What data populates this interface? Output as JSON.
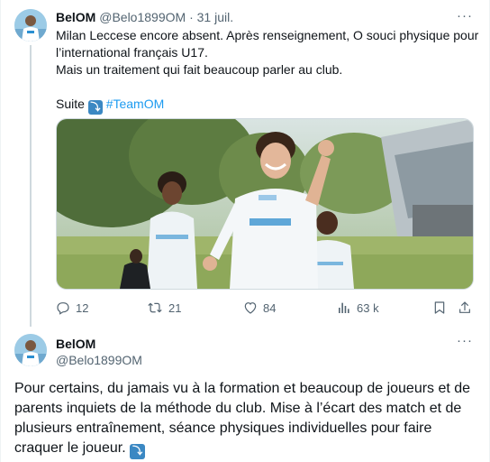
{
  "tweet1": {
    "author_name": "BelOM",
    "author_handle": "@Belo1899OM",
    "separator": "·",
    "date": "31 juil.",
    "more_label": "···",
    "lines": [
      "Milan Leccese encore absent. Après renseignement, O souci physique pour",
      "l’international français U17.",
      "Mais un traitement qui fait beaucoup parler au club."
    ],
    "suite_label": "Suite",
    "hashtag": "#TeamOM",
    "image_alt": "Football players celebrating a goal",
    "stats": {
      "replies": "12",
      "reposts": "21",
      "likes": "84",
      "views": "63 k"
    }
  },
  "tweet2": {
    "author_name": "BelOM",
    "author_handle": "@Belo1899OM",
    "more_label": "···",
    "text": "Pour certains, du jamais vu à la formation et beaucoup de joueurs et de parents inquiets de la méthode du club. Mise à l’écart des match et de plusieurs entraînement, séance physiques individuelles pour faire craquer le joueur."
  },
  "icons": {
    "down_arrow_emoji": "⤵",
    "reply": "reply-icon",
    "repost": "repost-icon",
    "like": "heart-icon",
    "views": "views-icon",
    "bookmark": "bookmark-icon",
    "share": "share-icon"
  },
  "colors": {
    "link_blue": "#1d9bf0",
    "secondary_text": "#536471",
    "divider": "#eff3f4",
    "emoji_blue": "#3b88c3"
  }
}
